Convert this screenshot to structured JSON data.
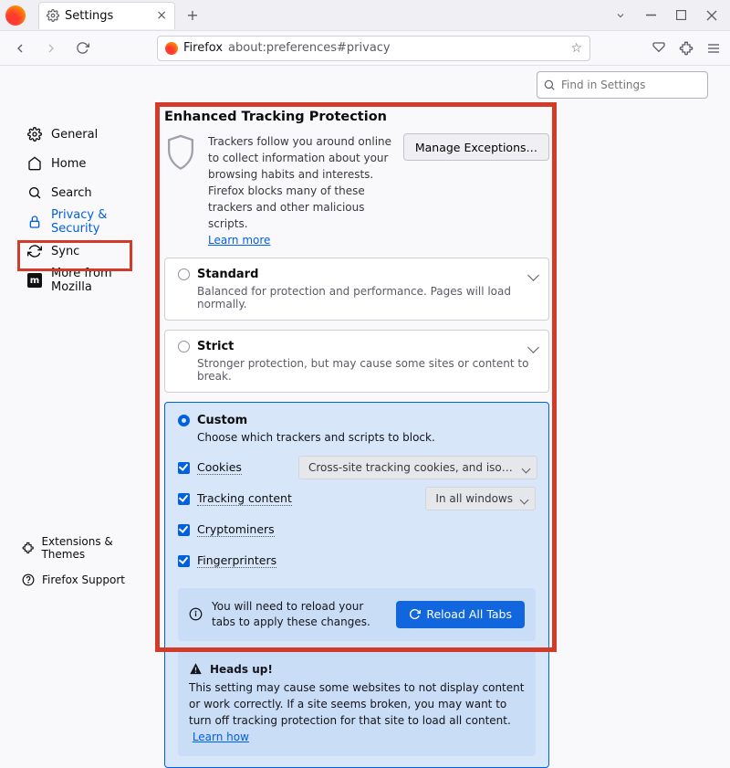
{
  "tab": {
    "title": "Settings"
  },
  "url": {
    "product": "Firefox",
    "text": "about:preferences#privacy"
  },
  "findPlaceholder": "Find in Settings",
  "sidebar": {
    "items": [
      {
        "label": "General"
      },
      {
        "label": "Home"
      },
      {
        "label": "Search"
      },
      {
        "label": "Privacy & Security"
      },
      {
        "label": "Sync"
      },
      {
        "label": "More from Mozilla"
      }
    ],
    "footer": {
      "extensions": "Extensions & Themes",
      "support": "Firefox Support"
    }
  },
  "etp": {
    "title": "Enhanced Tracking Protection",
    "body": "Trackers follow you around online to collect information about your browsing habits and interests. Firefox blocks many of these trackers and other malicious scripts.",
    "learn": "Learn more",
    "manage": "Manage Exceptions…"
  },
  "options": {
    "standard": {
      "title": "Standard",
      "desc": "Balanced for protection and performance. Pages will load normally."
    },
    "strict": {
      "title": "Strict",
      "desc": "Stronger protection, but may cause some sites or content to break."
    },
    "custom": {
      "title": "Custom",
      "desc": "Choose which trackers and scripts to block."
    }
  },
  "custom": {
    "cookies": "Cookies",
    "cookiesDropdown": "Cross-site tracking cookies, and isolate other cross-site c…",
    "tracking": "Tracking content",
    "trackingDropdown": "In all windows",
    "crypto": "Cryptominers",
    "finger": "Fingerprinters"
  },
  "reload": {
    "msg": "You will need to reload your tabs to apply these changes.",
    "btn": "Reload All Tabs"
  },
  "warn": {
    "title": "Heads up!",
    "body": "This setting may cause some websites to not display content or work correctly. If a site seems broken, you may want to turn off tracking protection for that site to load all content.",
    "link": "Learn how"
  }
}
